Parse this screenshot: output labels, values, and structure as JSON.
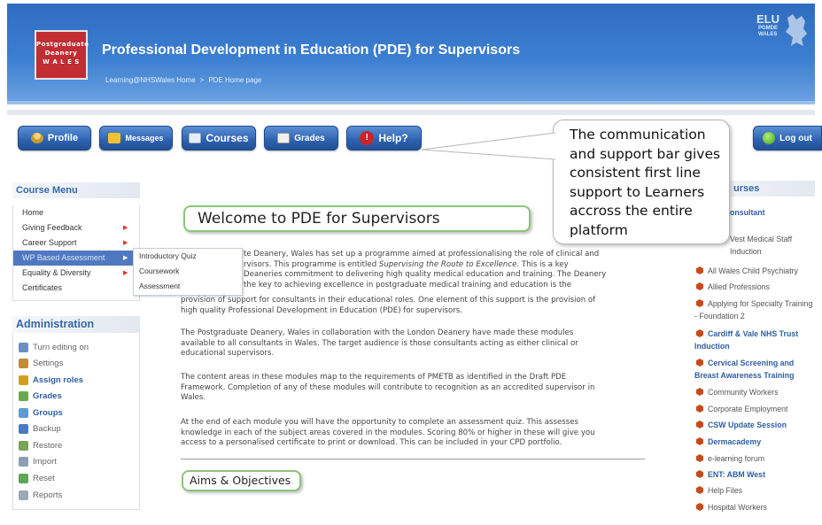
{
  "header": {
    "logo_lines": [
      "Postgraduate",
      "Deanery",
      "W A L E S"
    ],
    "site_title": "Professional Development in Education (PDE) for Supervisors",
    "breadcrumb": [
      "Learning@NHSWales Home",
      "PDE Home page"
    ],
    "breadcrumb_sep": ">",
    "partner_logo": {
      "name": "ELU",
      "sub": [
        "PGMDE",
        "WALES"
      ]
    }
  },
  "nav": {
    "profile": "Profile",
    "messages": "Messages",
    "courses": "Courses",
    "grades": "Grades",
    "help": "Help?",
    "logout": "Log out"
  },
  "callout": {
    "text": "The communication and support bar gives consistent first line support to Learners accross the entire platform"
  },
  "course_menu": {
    "title": "Course Menu",
    "items": [
      {
        "label": "Home",
        "has_submenu": false,
        "active": false
      },
      {
        "label": "Giving Feedback",
        "has_submenu": true,
        "active": false
      },
      {
        "label": "Career Support",
        "has_submenu": true,
        "active": false
      },
      {
        "label": "WP Based Assessment",
        "has_submenu": true,
        "active": true
      },
      {
        "label": "Equality & Diversity",
        "has_submenu": true,
        "active": false
      },
      {
        "label": "Certificates",
        "has_submenu": false,
        "active": false
      }
    ],
    "submenu": [
      "Introductory Quiz",
      "Coursework",
      "Assessment"
    ],
    "arrow": "▶"
  },
  "administration": {
    "title": "Administration",
    "items": [
      {
        "label": "Turn editing on",
        "icon": "edit-icon",
        "strong": false,
        "color": "#6b8fc2"
      },
      {
        "label": "Settings",
        "icon": "settings-icon",
        "strong": false,
        "color": "#c58a3a"
      },
      {
        "label": "Assign roles",
        "icon": "roles-icon",
        "strong": true,
        "color": "#d4a017"
      },
      {
        "label": "Grades",
        "icon": "grades-icon",
        "strong": true,
        "color": "#6aa84f"
      },
      {
        "label": "Groups",
        "icon": "groups-icon",
        "strong": true,
        "color": "#5b9bd5"
      },
      {
        "label": "Backup",
        "icon": "backup-icon",
        "strong": false,
        "color": "#4a7bc0"
      },
      {
        "label": "Restore",
        "icon": "restore-icon",
        "strong": false,
        "color": "#7aa35b"
      },
      {
        "label": "Import",
        "icon": "import-icon",
        "strong": false,
        "color": "#8c9eb5"
      },
      {
        "label": "Reset",
        "icon": "reset-icon",
        "strong": false,
        "color": "#5fa55a"
      },
      {
        "label": "Reports",
        "icon": "reports-icon",
        "strong": false,
        "color": "#9aa8b8"
      }
    ]
  },
  "main": {
    "welcome_title": "Welcome to PDE for Supervisors",
    "paragraphs": [
      {
        "parts": [
          {
            "t": "te Deanery, Wales has set up a programme aimed at professionalising the role of clinical and",
            "i": false,
            "br": true
          },
          {
            "t": "rvisors. This programme is entitled ",
            "i": false,
            "br": false
          },
          {
            "t": "Supervising the Route to Excellence",
            "i": true,
            "br": false
          },
          {
            "t": ". This is a key",
            "i": false,
            "br": true
          },
          {
            "t": "Deaneries commitment to delivering high quality medical education and training. The Deanery",
            "i": false,
            "br": true
          },
          {
            "t": "the key to achieving excellence in postgraduate medical training and education is the",
            "i": false,
            "br": true
          },
          {
            "t": "provision of support for consultants in their educational roles. One element of this support is the provision of",
            "i": false,
            "br": true
          },
          {
            "t": "high quality Professional Development in Education (PDE) for supervisors.",
            "i": false,
            "br": false
          }
        ]
      },
      {
        "parts": [
          {
            "t": "The Postgraduate Deanery, Wales in collaboration with the London Deanery have made these modules",
            "i": false,
            "br": true
          },
          {
            "t": "available to all consultants in Wales. The target audience is those consultants acting as either clinical or",
            "i": false,
            "br": true
          },
          {
            "t": "educational supervisors.",
            "i": false,
            "br": false
          }
        ]
      },
      {
        "parts": [
          {
            "t": "The content areas in these modules map to the requirements of PMETB as identified in the Draft PDE",
            "i": false,
            "br": true
          },
          {
            "t": "Framework. Completion of any of these modules will contribute to recognition as an accredited supervisor in",
            "i": false,
            "br": true
          },
          {
            "t": "Wales.",
            "i": false,
            "br": false
          }
        ]
      },
      {
        "parts": [
          {
            "t": "At the end of each module you will have the opportunity to complete an assessment quiz. This assesses",
            "i": false,
            "br": true
          },
          {
            "t": "knowledge in each of the subject areas covered in the modules. Scoring 80% or higher in these will give you",
            "i": false,
            "br": true
          },
          {
            "t": "access to a personalised certificate to print or download. This can be included in your CPD portfolio.",
            "i": false,
            "br": false
          }
        ]
      }
    ],
    "aims_title": "Aims & Objectives"
  },
  "courses": {
    "title_partial": "urses",
    "items": [
      {
        "label": "onsultant",
        "strong": true,
        "icon": false
      },
      {
        "label": "",
        "strong": false,
        "icon": false
      },
      {
        "label": "Vest Medical Staff Induction",
        "strong": false,
        "icon": false
      },
      {
        "label": "All Wales Child Psychiatry",
        "strong": false,
        "icon": true
      },
      {
        "label": "Allied Professions",
        "strong": false,
        "icon": true
      },
      {
        "label": "Applying for Specialty Training - Foundation 2",
        "strong": false,
        "icon": true
      },
      {
        "label": "Cardiff & Vale NHS Trust Induction",
        "strong": true,
        "icon": true
      },
      {
        "label": "Cervical Screening and Breast Awareness Training",
        "strong": true,
        "icon": true
      },
      {
        "label": "Community Workers",
        "strong": false,
        "icon": true
      },
      {
        "label": "Corporate Employment",
        "strong": false,
        "icon": true
      },
      {
        "label": "CSW Update Session",
        "strong": true,
        "icon": true
      },
      {
        "label": "Dermacademy",
        "strong": true,
        "icon": true
      },
      {
        "label": "e-learning forum",
        "strong": false,
        "icon": true
      },
      {
        "label": "ENT: ABM West",
        "strong": true,
        "icon": true
      },
      {
        "label": "Help Files",
        "strong": false,
        "icon": true
      },
      {
        "label": "Hospital Workers",
        "strong": false,
        "icon": true
      }
    ]
  },
  "colors": {
    "header_blue": "#3c7fd0",
    "nav_button_blue": "#2d62b0",
    "link_blue": "#2f5f9f",
    "green_border": "#8cc47a",
    "logo_red": "#c22c33",
    "active_menu": "#4f78c0"
  }
}
